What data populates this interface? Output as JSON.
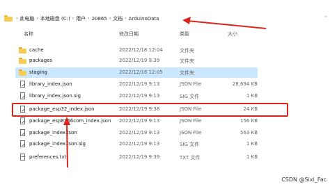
{
  "breadcrumbs": [
    "此电脑",
    "本地磁盘 (C:)",
    "用户",
    "20865",
    "文档",
    "ArduinoData"
  ],
  "columns": {
    "name": "名称",
    "date": "修改日期",
    "type": "类型",
    "size": "大小"
  },
  "files": [
    {
      "name": "cache",
      "date": "2022/12/18 12:04",
      "type": "文件夹",
      "size": "",
      "kind": "folder"
    },
    {
      "name": "packages",
      "date": "2022/12/19 9:39",
      "type": "文件夹",
      "size": "",
      "kind": "folder"
    },
    {
      "name": "staging",
      "date": "2022/12/18 12:05",
      "type": "文件夹",
      "size": "",
      "kind": "folder",
      "selected": true
    },
    {
      "name": "library_index.json",
      "date": "2022/12/19 9:13",
      "type": "JSON File",
      "size": "28,694 KB",
      "kind": "file"
    },
    {
      "name": "library_index.json.sig",
      "date": "2022/12/19 9:13",
      "type": "SIG 文件",
      "size": "1 KB",
      "kind": "file"
    },
    {
      "name": "package_esp32_index.json",
      "date": "2022/12/19 9:38",
      "type": "JSON File",
      "size": "24 KB",
      "kind": "file",
      "highlighted": true
    },
    {
      "name": "package_esp8266com_index.json",
      "date": "2022/12/19 9:13",
      "type": "JSON File",
      "size": "156 KB",
      "kind": "file"
    },
    {
      "name": "package_index.json",
      "date": "2022/12/19 9:13",
      "type": "JSON File",
      "size": "563 KB",
      "kind": "file"
    },
    {
      "name": "package_index.json.sig",
      "date": "2022/12/19 9:13",
      "type": "SIG 文件",
      "size": "1 KB",
      "kind": "file"
    },
    {
      "name": "preferences.txt",
      "date": "2022/12/19 9:39",
      "type": "TXT 文件",
      "size": "1 KB",
      "kind": "txt"
    }
  ],
  "watermark": "CSDN @Sixi_Fac",
  "colors": {
    "annotation": "#d9261c",
    "selection": "#cce8ff"
  }
}
